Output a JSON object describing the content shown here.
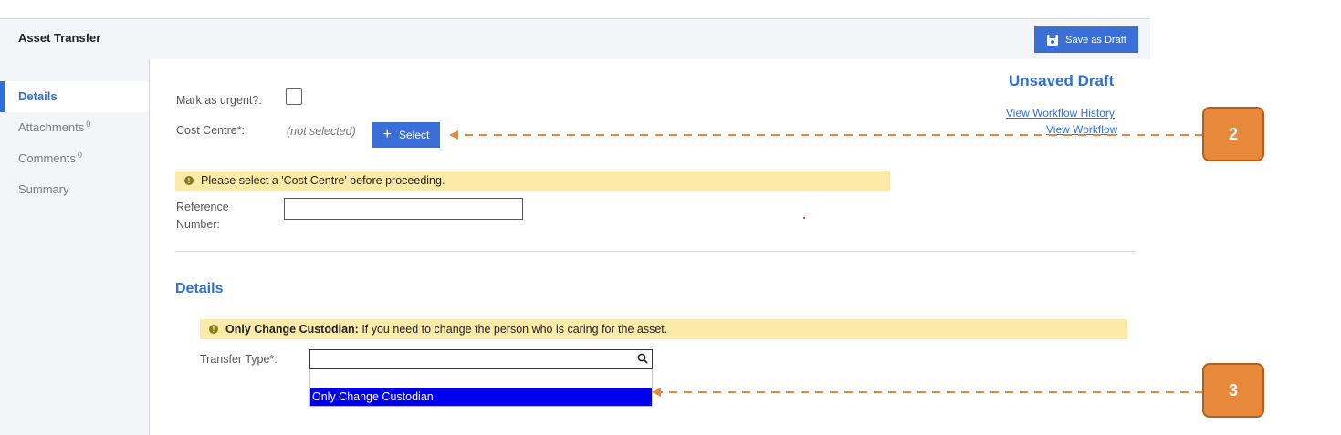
{
  "header": {
    "title": "Asset Transfer",
    "save_draft_label": "Save as Draft"
  },
  "sidebar": {
    "items": [
      {
        "label": "Details",
        "count": ""
      },
      {
        "label": "Attachments",
        "count": "0"
      },
      {
        "label": "Comments",
        "count": "0"
      },
      {
        "label": "Summary",
        "count": ""
      }
    ]
  },
  "form": {
    "urgent_label": "Mark as urgent?:",
    "cost_centre_label": "Cost Centre*:",
    "cost_centre_value": "(not selected)",
    "select_button_label": "Select",
    "status": "Unsaved Draft",
    "view_workflow_history": "View Workflow History",
    "view_workflow": "View Workflow",
    "cost_centre_warning": "Please select a 'Cost Centre' before proceeding.",
    "reference_label_line1": "Reference",
    "reference_label_line2": "Number:",
    "reference_value": ""
  },
  "details": {
    "title": "Details",
    "note_bold": "Only Change Custodian:",
    "note_text": " If you need to change the person who is caring for the asset.",
    "transfer_type_label": "Transfer Type*:",
    "transfer_type_value": "",
    "options": [
      "",
      "Only Change Custodian"
    ]
  },
  "callouts": [
    "2",
    "3"
  ],
  "colors": {
    "accent": "#3a6fd8",
    "callout": "#e8883b",
    "warning_bg": "#fbeaa8"
  }
}
